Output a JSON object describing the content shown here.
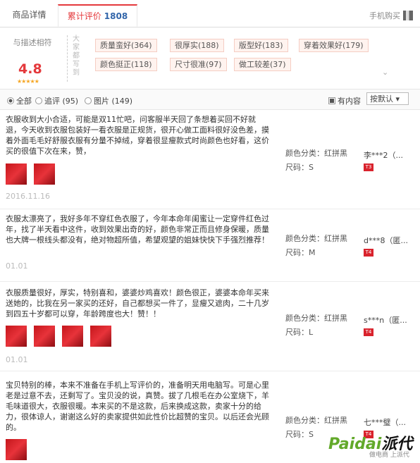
{
  "tabs": {
    "detail": "商品详情",
    "reviews": "累计评价",
    "review_count": "1808",
    "mobile_buy": "手机购买"
  },
  "summary": {
    "score_label": "与描述相符",
    "score": "4.8",
    "stars": "★★★★★",
    "impression_label": "大家都写到",
    "tags": [
      "质量蛮好(364)",
      "很厚实(188)",
      "版型好(183)",
      "穿着效果好(179)",
      "颜色挺正(118)",
      "尺寸很准(97)",
      "做工较差(37)"
    ],
    "more_icon": "chevron-down-icon"
  },
  "filters": {
    "all": "全部",
    "append": "追评 (95)",
    "pictures": "图片 (149)",
    "have_content": "有内容",
    "sort": "按默认"
  },
  "reviews": [
    {
      "text": "衣服收到大小合适，可能是双11忙吧，问客服半天回了条想着买回不好就退，今天收到衣服包装好一看衣服是正规货，很开心做工面料很好没色差，摸着外面毛毛好舒服衣服有分量不掉绒，穿着很显瘦款式时尚颜色也好看，这价买的很值下次在来，赞，",
      "date": "2016.11.16",
      "color": "颜色分类：红拼黑",
      "size": "尺码：S",
      "user": "李***2（...",
      "badge": "T3"
    },
    {
      "text": "衣服太漂亮了，我好多年不穿红色衣服了，今年本命年闺蜜让一定穿件红色过年，找了半天看中这件，收到效果出奇的好，颜色非常正而且修身保暖，质量也大牌一根线头都没有，绝对物超所值，希望观望的姐妹快快下手强烈推荐！",
      "date": "01.01",
      "color": "颜色分类：红拼黑",
      "size": "尺码：M",
      "user": "d***8（匿...",
      "badge": "T4"
    },
    {
      "text": "衣服质量很好，厚实，特别喜和，婆婆炒鸡喜欢！颜色很正，婆婆本命年买来送她的，比我在另一家买的还好，自己都想买一件了，显瘦又遮肉，二十几岁到四五十岁都可以穿，年龄跨度也大！赞！！",
      "date": "01.01",
      "color": "颜色分类：红拼黑",
      "size": "尺码：L",
      "user": "s***n（匿...",
      "badge": "T4"
    },
    {
      "text": "宝贝特别的棒，本来不准备在手机上写评价的，准备明天用电脑写。可是心里老是过意不去，还剩写了。宝贝没的说，真赞。拔了几根毛在办公室烧下，羊毛味道很大，衣服很暖。本来买的不是这款，后来换成这款，卖家十分的给力，很体谅人，谢谢这么好的卖家提供如此性价比超赞的宝贝。以后还会光顾的。",
      "date": "",
      "color": "颜色分类：红拼黑",
      "size": "尺码：S",
      "user": "七***璧（...",
      "badge": "T4"
    }
  ],
  "watermark": {
    "brand_a": "Paidai",
    "brand_b": "派代",
    "sub": "做电商 上派代"
  }
}
